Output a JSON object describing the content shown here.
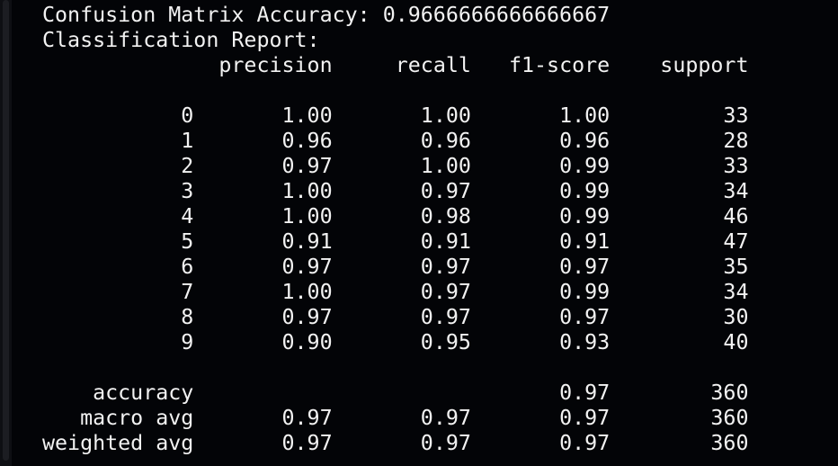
{
  "terminal": {
    "accuracy_line": "Confusion Matrix Accuracy: 0.9666666666666667",
    "report_title": "Classification Report:",
    "columns": [
      "precision",
      "recall",
      "f1-score",
      "support"
    ],
    "rows": [
      {
        "label": "0",
        "precision": "1.00",
        "recall": "1.00",
        "f1": "1.00",
        "support": "33"
      },
      {
        "label": "1",
        "precision": "0.96",
        "recall": "0.96",
        "f1": "0.96",
        "support": "28"
      },
      {
        "label": "2",
        "precision": "0.97",
        "recall": "1.00",
        "f1": "0.99",
        "support": "33"
      },
      {
        "label": "3",
        "precision": "1.00",
        "recall": "0.97",
        "f1": "0.99",
        "support": "34"
      },
      {
        "label": "4",
        "precision": "1.00",
        "recall": "0.98",
        "f1": "0.99",
        "support": "46"
      },
      {
        "label": "5",
        "precision": "0.91",
        "recall": "0.91",
        "f1": "0.91",
        "support": "47"
      },
      {
        "label": "6",
        "precision": "0.97",
        "recall": "0.97",
        "f1": "0.97",
        "support": "35"
      },
      {
        "label": "7",
        "precision": "1.00",
        "recall": "0.97",
        "f1": "0.99",
        "support": "34"
      },
      {
        "label": "8",
        "precision": "0.97",
        "recall": "0.97",
        "f1": "0.97",
        "support": "30"
      },
      {
        "label": "9",
        "precision": "0.90",
        "recall": "0.95",
        "f1": "0.93",
        "support": "40"
      }
    ],
    "summary": [
      {
        "label": "accuracy",
        "precision": "",
        "recall": "",
        "f1": "0.97",
        "support": "360"
      },
      {
        "label": "macro avg",
        "precision": "0.97",
        "recall": "0.97",
        "f1": "0.97",
        "support": "360"
      },
      {
        "label": "weighted avg",
        "precision": "0.97",
        "recall": "0.97",
        "f1": "0.97",
        "support": "360"
      }
    ],
    "colors": {
      "background": "#030407",
      "text": "#f2f2f2"
    }
  }
}
